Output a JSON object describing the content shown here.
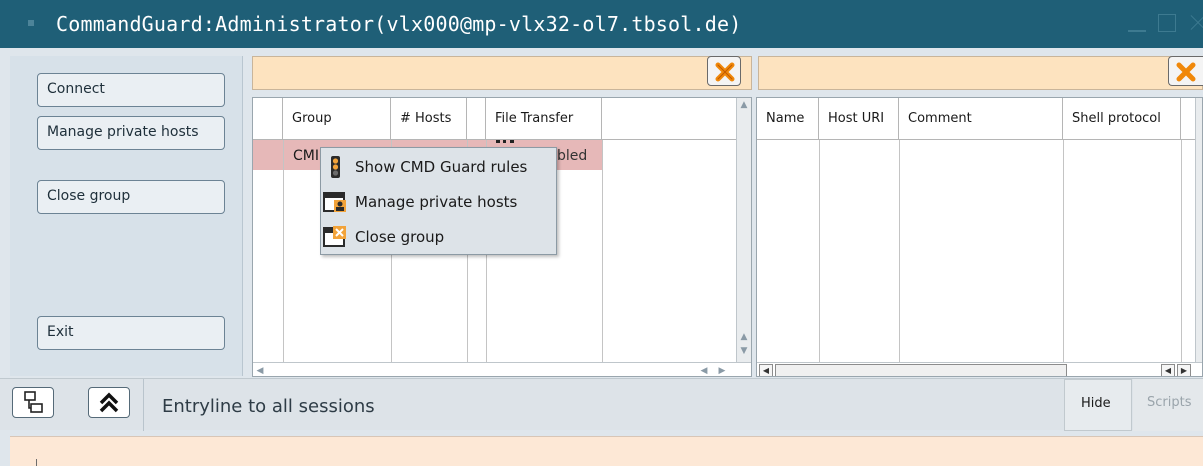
{
  "window": {
    "title": "CommandGuard:Administrator(vlx000@mp-vlx32-ol7.tbsol.de)"
  },
  "left_panel": {
    "connect_label": "Connect",
    "manage_private_hosts_label": "Manage private hosts",
    "close_group_label": "Close group",
    "exit_label": "Exit"
  },
  "groups_table": {
    "columns": [
      "Group",
      "# Hosts",
      "File Transfer"
    ],
    "rows": [
      {
        "group": "CMI",
        "hosts": "",
        "file_transfer": "bled"
      }
    ]
  },
  "hosts_table": {
    "columns": [
      "Name",
      "Host URI",
      "Comment",
      "Shell protocol"
    ]
  },
  "context_menu": {
    "items": [
      {
        "label": "Show CMD Guard rules",
        "icon": "traffic-light-icon"
      },
      {
        "label": "Manage private hosts",
        "icon": "window-user-icon"
      },
      {
        "label": "Close group",
        "icon": "window-close-icon"
      }
    ]
  },
  "bottom_bar": {
    "entryline_label": "Entryline to all sessions",
    "hide_label": "Hide",
    "scripts_label": "Scripts"
  },
  "colors": {
    "titlebar": "#1f5f77",
    "filter_bg": "#fde3bf",
    "selected_row": "#e6b8b8",
    "clear_icon": "#f0880a"
  }
}
